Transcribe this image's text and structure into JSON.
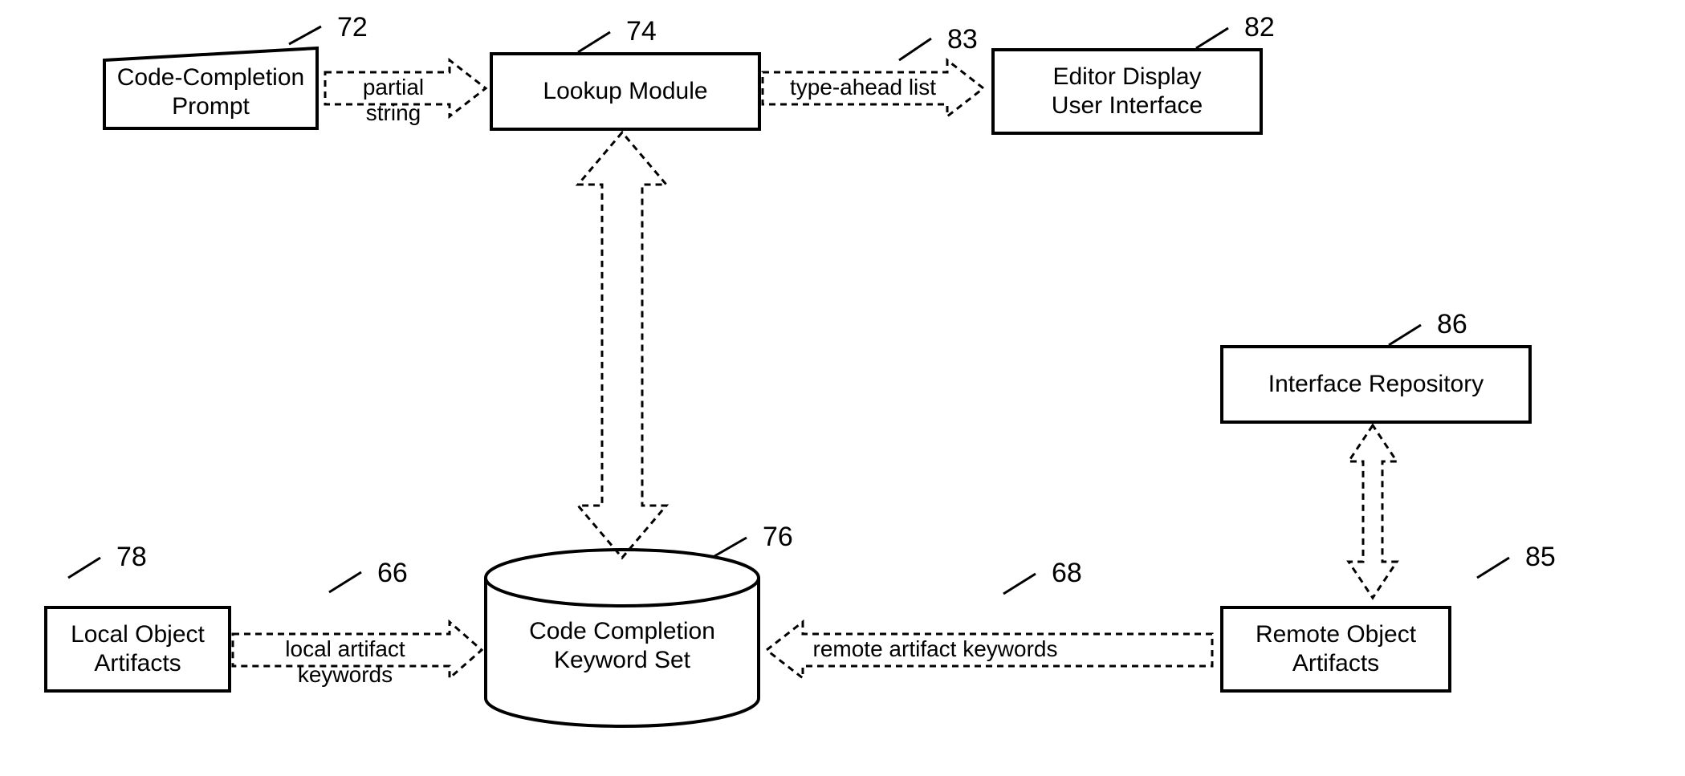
{
  "refs": {
    "r72": "72",
    "r74": "74",
    "r83": "83",
    "r82": "82",
    "r86": "86",
    "r76": "76",
    "r78": "78",
    "r66": "66",
    "r68": "68",
    "r85": "85"
  },
  "boxes": {
    "codeCompletionPrompt": "Code-Completion\nPrompt",
    "lookupModule": "Lookup Module",
    "editorDisplay": "Editor Display\nUser Interface",
    "interfaceRepository": "Interface Repository",
    "localObjectArtifacts": "Local Object\nArtifacts",
    "codeCompletionKeywordSet": "Code Completion\nKeyword Set",
    "remoteObjectArtifacts": "Remote Object\nArtifacts"
  },
  "arrows": {
    "partialString": "partial string",
    "typeAheadList": "type-ahead list",
    "localArtifactKeywords": "local artifact keywords",
    "remoteArtifactKeywords": "remote artifact keywords"
  }
}
